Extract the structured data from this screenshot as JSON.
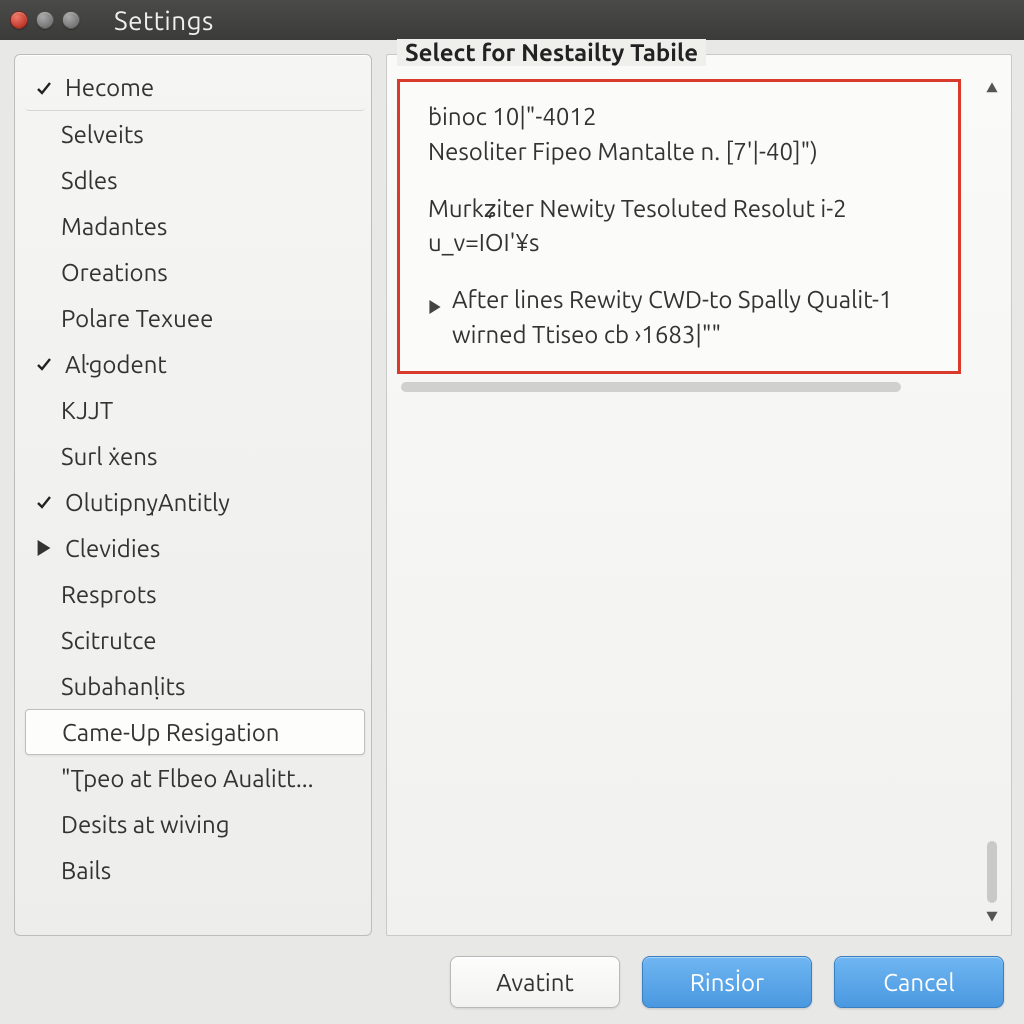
{
  "window": {
    "title": "Settings"
  },
  "sidebar": {
    "items": [
      {
        "label": "Hecome",
        "kind": "top",
        "icon": "check",
        "selected": false,
        "extra_class": "hecome"
      },
      {
        "label": "Selveits",
        "kind": "leaf"
      },
      {
        "label": "Sdles",
        "kind": "leaf"
      },
      {
        "label": "Madantes",
        "kind": "leaf"
      },
      {
        "label": "Oreations",
        "kind": "leaf"
      },
      {
        "label": "Polare Texuee",
        "kind": "leaf"
      },
      {
        "label": "Aŀgodent",
        "kind": "top",
        "icon": "check"
      },
      {
        "label": "KJJT",
        "kind": "leaf"
      },
      {
        "label": "Surl ẋens",
        "kind": "leaf"
      },
      {
        "label": "Olutipny̩Antitly",
        "kind": "top",
        "icon": "check"
      },
      {
        "label": "Clevidies",
        "kind": "top",
        "icon": "triangle"
      },
      {
        "label": "Resprots",
        "kind": "leaf"
      },
      {
        "label": "Scitrutce",
        "kind": "leaf"
      },
      {
        "label": "Subahanḷits",
        "kind": "leaf"
      },
      {
        "label": "Came-Up Resigation",
        "kind": "leaf",
        "selected": true
      },
      {
        "label": "\"Ʈpeo at Flbeo Aualitt...",
        "kind": "leaf"
      },
      {
        "label": "Desits at wiving",
        "kind": "leaf"
      },
      {
        "label": "Bails",
        "kind": "leaf"
      }
    ]
  },
  "detail": {
    "legend": "Select for Nestailty Tabile",
    "block1_line1": "ḃinoc 10|\"-4012",
    "block1_line2": "Nesoliter Fipeo Mantalte n. [7'|-40]\")",
    "block2_line1": "Murkʑiter Newity Tesoluted Resolut i-2",
    "block2_line2": "u_v=IOI'¥s",
    "block3_line1": "After lines Rewity CWD-to Spally Qualit-1",
    "block3_line2": "wirned Ttiseo cb ›1683|\"\""
  },
  "buttons": {
    "avatint": "Avatint",
    "rinstor": "Rinsİor",
    "cancel": "Cancel"
  }
}
